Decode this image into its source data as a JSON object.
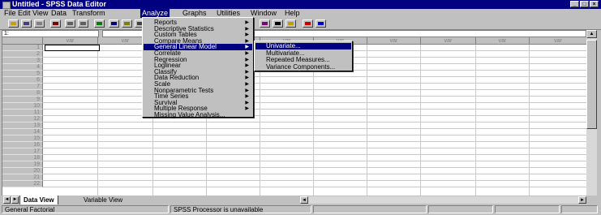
{
  "window": {
    "title": "Untitled - SPSS Data Editor",
    "controls": [
      "minimize",
      "maximize",
      "close"
    ]
  },
  "menubar": {
    "items": [
      {
        "label": "File"
      },
      {
        "label": "Edit"
      },
      {
        "label": "View"
      },
      {
        "label": "Data"
      },
      {
        "label": "Transform"
      },
      {
        "label": "Analyze",
        "active": true
      },
      {
        "label": "Graphs"
      },
      {
        "label": "Utilities"
      },
      {
        "label": "Window"
      },
      {
        "label": "Help"
      }
    ]
  },
  "toolbar": {
    "buttons": [
      "open-icon",
      "save-icon",
      "print-icon",
      "dialog-recall-icon",
      "undo-icon",
      "redo-icon",
      "goto-chart-icon",
      "goto-case-icon",
      "variables-icon",
      "find-icon",
      "insert-case-icon",
      "insert-variable-icon",
      "split-file-icon",
      "weight-cases-icon",
      "select-cases-icon",
      "value-labels-icon",
      "use-sets-icon"
    ]
  },
  "cell_editor": {
    "reference": "1:",
    "value": ""
  },
  "grid": {
    "column_header": "var",
    "column_count": 10,
    "row_labels": [
      "1",
      "2",
      "3",
      "4",
      "5",
      "6",
      "7",
      "8",
      "9",
      "10",
      "11",
      "12",
      "13",
      "14",
      "15",
      "16",
      "17",
      "18",
      "19",
      "20",
      "21",
      "22"
    ]
  },
  "analyze_menu": {
    "items": [
      {
        "label": "Reports",
        "submenu": true
      },
      {
        "label": "Descriptive Statistics",
        "submenu": true
      },
      {
        "label": "Custom Tables",
        "submenu": true
      },
      {
        "label": "Compare Means",
        "submenu": true
      },
      {
        "label": "General Linear Model",
        "submenu": true,
        "highlighted": true
      },
      {
        "label": "Correlate",
        "submenu": true
      },
      {
        "label": "Regression",
        "submenu": true
      },
      {
        "label": "Loglinear",
        "submenu": true
      },
      {
        "label": "Classify",
        "submenu": true
      },
      {
        "label": "Data Reduction",
        "submenu": true
      },
      {
        "label": "Scale",
        "submenu": true
      },
      {
        "label": "Nonparametric Tests",
        "submenu": true
      },
      {
        "label": "Time Series",
        "submenu": true
      },
      {
        "label": "Survival",
        "submenu": true
      },
      {
        "label": "Multiple Response",
        "submenu": true
      },
      {
        "label": "Missing Value Analysis...",
        "submenu": false
      }
    ]
  },
  "glm_submenu": {
    "items": [
      {
        "label": "Univariate...",
        "highlighted": true
      },
      {
        "label": "Multivariate..."
      },
      {
        "label": "Repeated Measures..."
      },
      {
        "label": "Variance Components..."
      }
    ]
  },
  "tabs": {
    "data_view": "Data View",
    "variable_view": "Variable View"
  },
  "status": {
    "left": "General Factorial",
    "processor": "SPSS Processor  is unavailable"
  },
  "colors": {
    "title_bar": "#000080",
    "highlight": "#000080",
    "chrome": "#c0c0c0"
  }
}
